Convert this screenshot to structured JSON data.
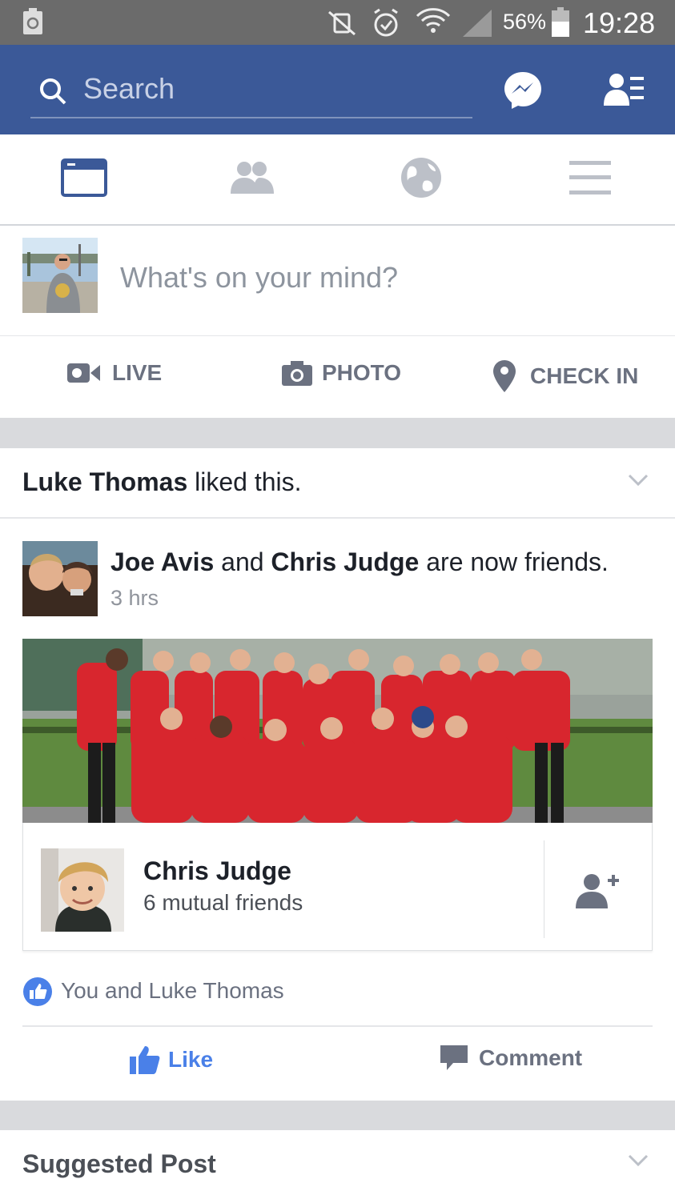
{
  "status_bar": {
    "battery_percent": "56%",
    "time": "19:28",
    "icons": [
      "recycle-icon",
      "vibrate-mute-icon",
      "alarm-icon",
      "wifi-icon",
      "signal-icon",
      "battery-icon"
    ]
  },
  "header": {
    "search_placeholder": "Search",
    "icons": [
      "search-icon",
      "messenger-icon",
      "friend-requests-icon"
    ],
    "brand_color": "#3b5998"
  },
  "nav_tabs": [
    {
      "name": "news-feed",
      "icon": "news-feed-icon",
      "active": true
    },
    {
      "name": "friends",
      "icon": "friends-icon",
      "active": false
    },
    {
      "name": "notifications",
      "icon": "globe-icon",
      "active": false
    },
    {
      "name": "menu",
      "icon": "hamburger-icon",
      "active": false
    }
  ],
  "composer": {
    "prompt": "What's on your mind?",
    "actions": [
      {
        "label": "LIVE",
        "icon": "video-camera-icon"
      },
      {
        "label": "PHOTO",
        "icon": "camera-icon"
      },
      {
        "label": "CHECK IN",
        "icon": "location-pin-icon"
      }
    ]
  },
  "story": {
    "context_actor": "Luke Thomas",
    "context_text": " liked this.",
    "friend_a": "Joe Avis",
    "and_text": " and ",
    "friend_b": "Chris Judge",
    "friends_text": " are now friends.",
    "time": "3 hrs",
    "card": {
      "name": "Chris Judge",
      "mutual": "6 mutual friends"
    },
    "likes_text": "You and Luke Thomas",
    "like_label": "Like",
    "comment_label": "Comment",
    "like_color": "#4a80e8"
  },
  "next_story": {
    "label": "Suggested Post"
  }
}
